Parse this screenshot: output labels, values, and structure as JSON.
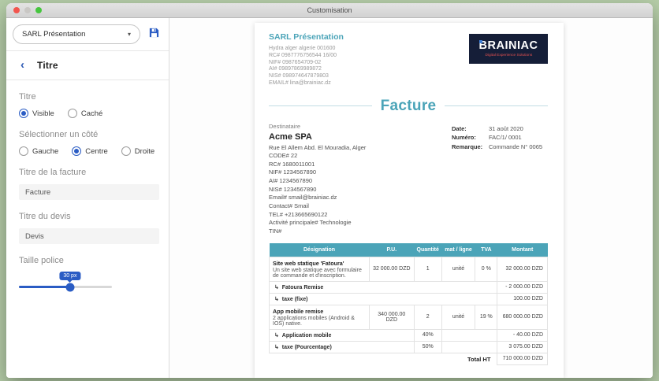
{
  "window": {
    "title": "Customisation"
  },
  "sidebar": {
    "template_dropdown": {
      "value": "SARL Présentation"
    },
    "panel": {
      "title": "Titre"
    },
    "title_section": {
      "label": "Titre",
      "options": [
        {
          "label": "Visible",
          "selected": true
        },
        {
          "label": "Caché",
          "selected": false
        }
      ]
    },
    "side_section": {
      "label": "Sélectionner un côté",
      "options": [
        {
          "label": "Gauche",
          "selected": false
        },
        {
          "label": "Centre",
          "selected": true
        },
        {
          "label": "Droite",
          "selected": false
        }
      ]
    },
    "invoice_title_field": {
      "label": "Titre de la facture",
      "value": "Facture"
    },
    "quote_title_field": {
      "label": "Titre du devis",
      "value": "Devis"
    },
    "font_size_slider": {
      "label": "Taille police",
      "value": "30 px",
      "percent": 55
    }
  },
  "invoice": {
    "company": {
      "name": "SARL Présentation",
      "lines": [
        "Hydra alger algerie 001600",
        "RC# 0987776756544 16/00",
        "NIF# 0987654709-02",
        "AI# 09897869989872",
        "NIS# 098974647879803",
        "EMAIL# lina@brainiac.dz"
      ]
    },
    "logo": {
      "name": "BRAINIAC",
      "tagline": "Digital Experience Solutions"
    },
    "doc_title": "Facture",
    "recipient": {
      "heading": "Destinataire",
      "name": "Acme SPA",
      "lines": [
        "Rue El Allem Abd. El Mouradia, Alger",
        "CODE# 22",
        "RC# 1680011001",
        "NIF# 1234567890",
        "AI# 1234567890",
        "NIS# 1234567890",
        "Email# smail@brainiac.dz",
        "Contact# Smail",
        "TEL# +213665690122",
        "Activité principale# Technologie",
        "TIN#"
      ]
    },
    "meta": {
      "date_label": "Date:",
      "date_value": "31 août 2020",
      "number_label": "Numéro:",
      "number_value": "FAC/1/ 0001",
      "remark_label": "Remarque:",
      "remark_value": "Commande N° 0065"
    },
    "table": {
      "headers": [
        "Désignation",
        "P.U.",
        "Quantité",
        "mat / ligne",
        "TVA",
        "Montant"
      ],
      "rows": [
        {
          "title": "Site web statique 'Fatoura'",
          "desc": "Un site web statique avec formulaire de commande et d'inscription.",
          "pu": "32 000.00 DZD",
          "qty": "1",
          "unit": "unité",
          "tva": "0 %",
          "amount": "32 000.00 DZD"
        },
        {
          "label": "Fatoura Remise",
          "amount": "- 2 000.00 DZD"
        },
        {
          "label": "taxe (fixe)",
          "amount": "100.00 DZD"
        },
        {
          "title": "App mobile remise",
          "desc": "2 applications mobiles (Android & IOS) native.",
          "pu": "340 000.00 DZD",
          "qty": "2",
          "unit": "unité",
          "tva": "19 %",
          "amount": "680 000.00 DZD"
        },
        {
          "label": "Application mobile",
          "qty": "40%",
          "amount": "- 40.00 DZD"
        },
        {
          "label": "taxe (Pourcentage)",
          "qty": "50%",
          "amount": "3 075.00 DZD"
        }
      ],
      "total_label": "Total HT",
      "total_value": "710 000.00 DZD"
    }
  },
  "colors": {
    "accent_blue": "#2a5cc4",
    "teal": "#4ba4b8",
    "logo_navy": "#151e38",
    "logo_red": "#e05050",
    "desktop_green": "#b5cda8"
  }
}
